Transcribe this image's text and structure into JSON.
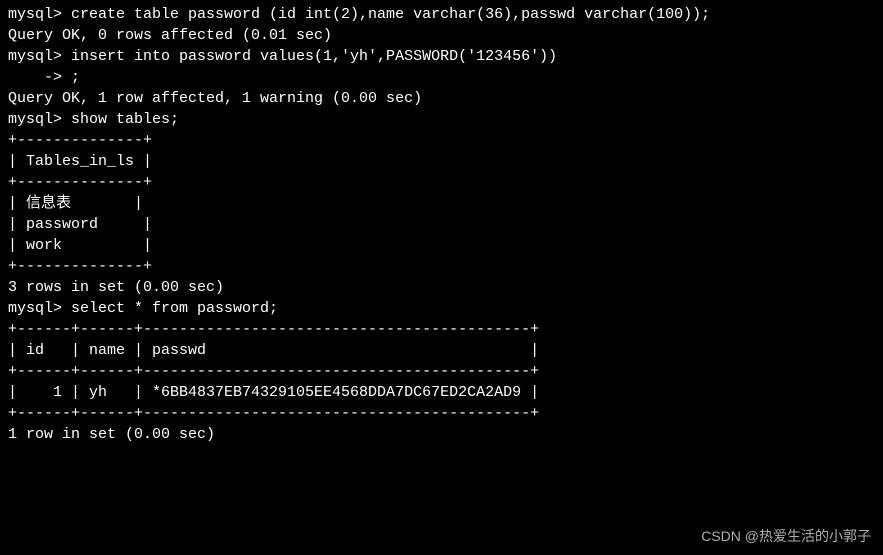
{
  "lines": {
    "l1": "mysql> create table password (id int(2),name varchar(36),passwd varchar(100));",
    "l2": "Query OK, 0 rows affected (0.01 sec)",
    "l3": "",
    "l4": "mysql> insert into password values(1,'yh',PASSWORD('123456'))",
    "l5": "    -> ;",
    "l6": "Query OK, 1 row affected, 1 warning (0.00 sec)",
    "l7": "",
    "l8": "mysql> show tables;",
    "l9": "+--------------+",
    "l10": "| Tables_in_ls |",
    "l11": "+--------------+",
    "l12": "| 信息表       |",
    "l13": "| password     |",
    "l14": "| work         |",
    "l15": "+--------------+",
    "l16": "3 rows in set (0.00 sec)",
    "l17": "",
    "l18": "mysql> select * from password;",
    "l19": "+------+------+-------------------------------------------+",
    "l20": "| id   | name | passwd                                    |",
    "l21": "+------+------+-------------------------------------------+",
    "l22": "|    1 | yh   | *6BB4837EB74329105EE4568DDA7DC67ED2CA2AD9 |",
    "l23": "+------+------+-------------------------------------------+",
    "l24": "1 row in set (0.00 sec)"
  },
  "watermark": "CSDN @热爱生活的小郭子"
}
